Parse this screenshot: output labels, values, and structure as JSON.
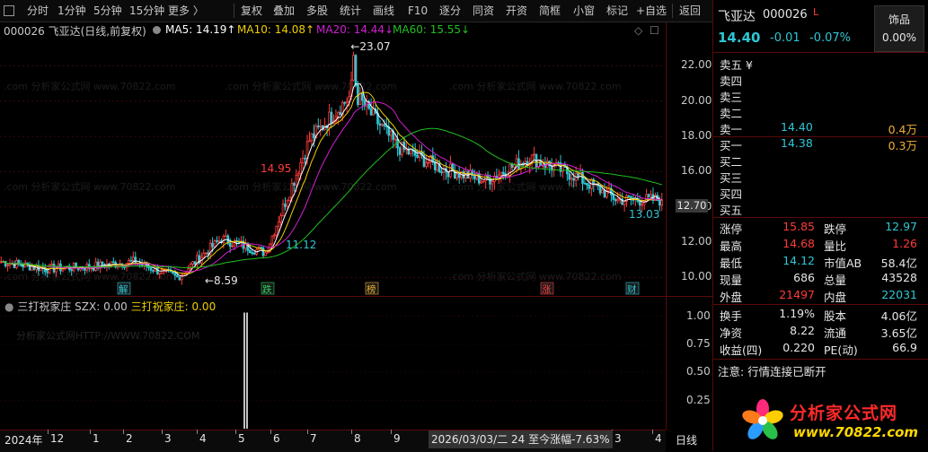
{
  "toolbar": {
    "left_items": [
      "分时",
      "1分钟",
      "5分钟",
      "15分钟",
      "更多 〉"
    ],
    "right_items": [
      "复权",
      "叠加",
      "多股",
      "统计",
      "画线",
      "F10",
      "逐分",
      "同资",
      "开资",
      "简框",
      "小窗",
      "标记",
      "+自选",
      "返回"
    ]
  },
  "chart_header": {
    "code_label": "000026 飞亚达(日线,前复权)",
    "ma5": "MA5: 14.19↑",
    "ma10": "MA10: 14.08↑",
    "ma20": "MA20: 14.44↓",
    "ma60": "MA60: 15.55↓"
  },
  "indicator_header": {
    "name": "三打祝家庄",
    "szx": "SZX: 0.00",
    "value": "三打祝家庄: 0.00"
  },
  "watermarks": {
    "main": ".com 分析家公式网 www.70822.com",
    "sub": "分析家公式网HTTP://WWW.70822.COM"
  },
  "chart_data": [
    {
      "type": "candlestick",
      "x": [
        "2024-12",
        "2025-01",
        "2025-02",
        "2025-03",
        "2025-04",
        "2025-05",
        "2025-06",
        "2025-07",
        "2025-08",
        "2025-09",
        "2025-10",
        "2025-11",
        "2025-12",
        "2026-01",
        "2026-02",
        "2026-03"
      ],
      "close_approx": [
        10.9,
        10.5,
        10.6,
        10.9,
        10.0,
        12.2,
        11.4,
        17.8,
        20.5,
        17.4,
        16.2,
        15.5,
        16.8,
        15.8,
        14.4,
        14.4
      ],
      "ylim": [
        9.0,
        23.5
      ],
      "y_ticks": [
        "22.00",
        "20.00",
        "18.00",
        "16.00",
        "14.00",
        "12.00",
        "10.00"
      ],
      "current_price_tag": "12.70",
      "annotations": {
        "high_label": "23.07",
        "peak1": "14.95",
        "low1": "11.12",
        "low_start": "8.59",
        "recent_low": "13.03"
      },
      "series": [
        {
          "name": "MA5",
          "color": "#ffffff"
        },
        {
          "name": "MA10",
          "color": "#f0d000"
        },
        {
          "name": "MA20",
          "color": "#d020d0"
        },
        {
          "name": "MA60",
          "color": "#20c020"
        }
      ],
      "event_markers": [
        {
          "label": "解",
          "color": "#2fc7d4"
        },
        {
          "label": "跌",
          "color": "#2fd060"
        },
        {
          "label": "榜",
          "color": "#f0b030"
        },
        {
          "label": "涨",
          "color": "#ff4040"
        },
        {
          "label": "财",
          "color": "#2fc7d4"
        }
      ]
    },
    {
      "type": "bar",
      "name": "三打祝家庄",
      "y_ticks": [
        "1.00",
        "0.75",
        "0.50",
        "0.25"
      ],
      "ylim": [
        0,
        1.1
      ],
      "spike_value": 1.0
    }
  ],
  "x_axis": {
    "labels": [
      "2024年",
      "12",
      "1",
      "2",
      "3",
      "4",
      "5",
      "6",
      "7",
      "8",
      "9",
      "3",
      "4"
    ],
    "cursor_info": "2026/03/03/二 24 至今涨幅-7.63%",
    "period": "日线"
  },
  "quote_panel": {
    "name": "飞亚达",
    "code": "000026",
    "flag": "L",
    "sector": "饰品",
    "sector_change": "0.00%",
    "price": "14.40",
    "change": "-0.01",
    "change_pct": "-0.07%",
    "order_book": {
      "sells": [
        {
          "label": "卖五 ¥",
          "price": "",
          "vol": ""
        },
        {
          "label": "卖四",
          "price": "",
          "vol": ""
        },
        {
          "label": "卖三",
          "price": "",
          "vol": ""
        },
        {
          "label": "卖二",
          "price": "",
          "vol": ""
        },
        {
          "label": "卖一",
          "price": "14.40",
          "vol": "0.4万"
        }
      ],
      "buys": [
        {
          "label": "买一",
          "price": "14.38",
          "vol": "0.3万"
        },
        {
          "label": "买二",
          "price": "",
          "vol": ""
        },
        {
          "label": "买三",
          "price": "",
          "vol": ""
        },
        {
          "label": "买四",
          "price": "",
          "vol": ""
        },
        {
          "label": "买五",
          "price": "",
          "vol": ""
        }
      ]
    },
    "stats": [
      {
        "l1": "涨停",
        "v1": "15.85",
        "c1": "rd",
        "l2": "跌停",
        "v2": "12.97",
        "c2": "cy"
      },
      {
        "l1": "最高",
        "v1": "14.68",
        "c1": "rd",
        "l2": "量比",
        "v2": "1.26",
        "c2": "rd"
      },
      {
        "l1": "最低",
        "v1": "14.12",
        "c1": "cy",
        "l2": "市值AB",
        "v2": "58.4亿",
        "c2": "wt"
      },
      {
        "l1": "现量",
        "v1": "686",
        "c1": "wt",
        "l2": "总量",
        "v2": "43528",
        "c2": "wt"
      },
      {
        "l1": "外盘",
        "v1": "21497",
        "c1": "rd",
        "l2": "内盘",
        "v2": "22031",
        "c2": "cy"
      }
    ],
    "fundamentals": [
      {
        "l1": "换手",
        "v1": "1.19%",
        "l2": "股本",
        "v2": "4.06亿"
      },
      {
        "l1": "净资",
        "v1": "8.22",
        "l2": "流通",
        "v2": "3.65亿"
      },
      {
        "l1": "收益(四)",
        "v1": "0.220",
        "l2": "PE(动)",
        "v2": "66.9"
      }
    ],
    "notice": "注意: 行情连接已断开"
  },
  "logo": {
    "text": "分析家公式网",
    "url_text": "www.70822.com"
  }
}
